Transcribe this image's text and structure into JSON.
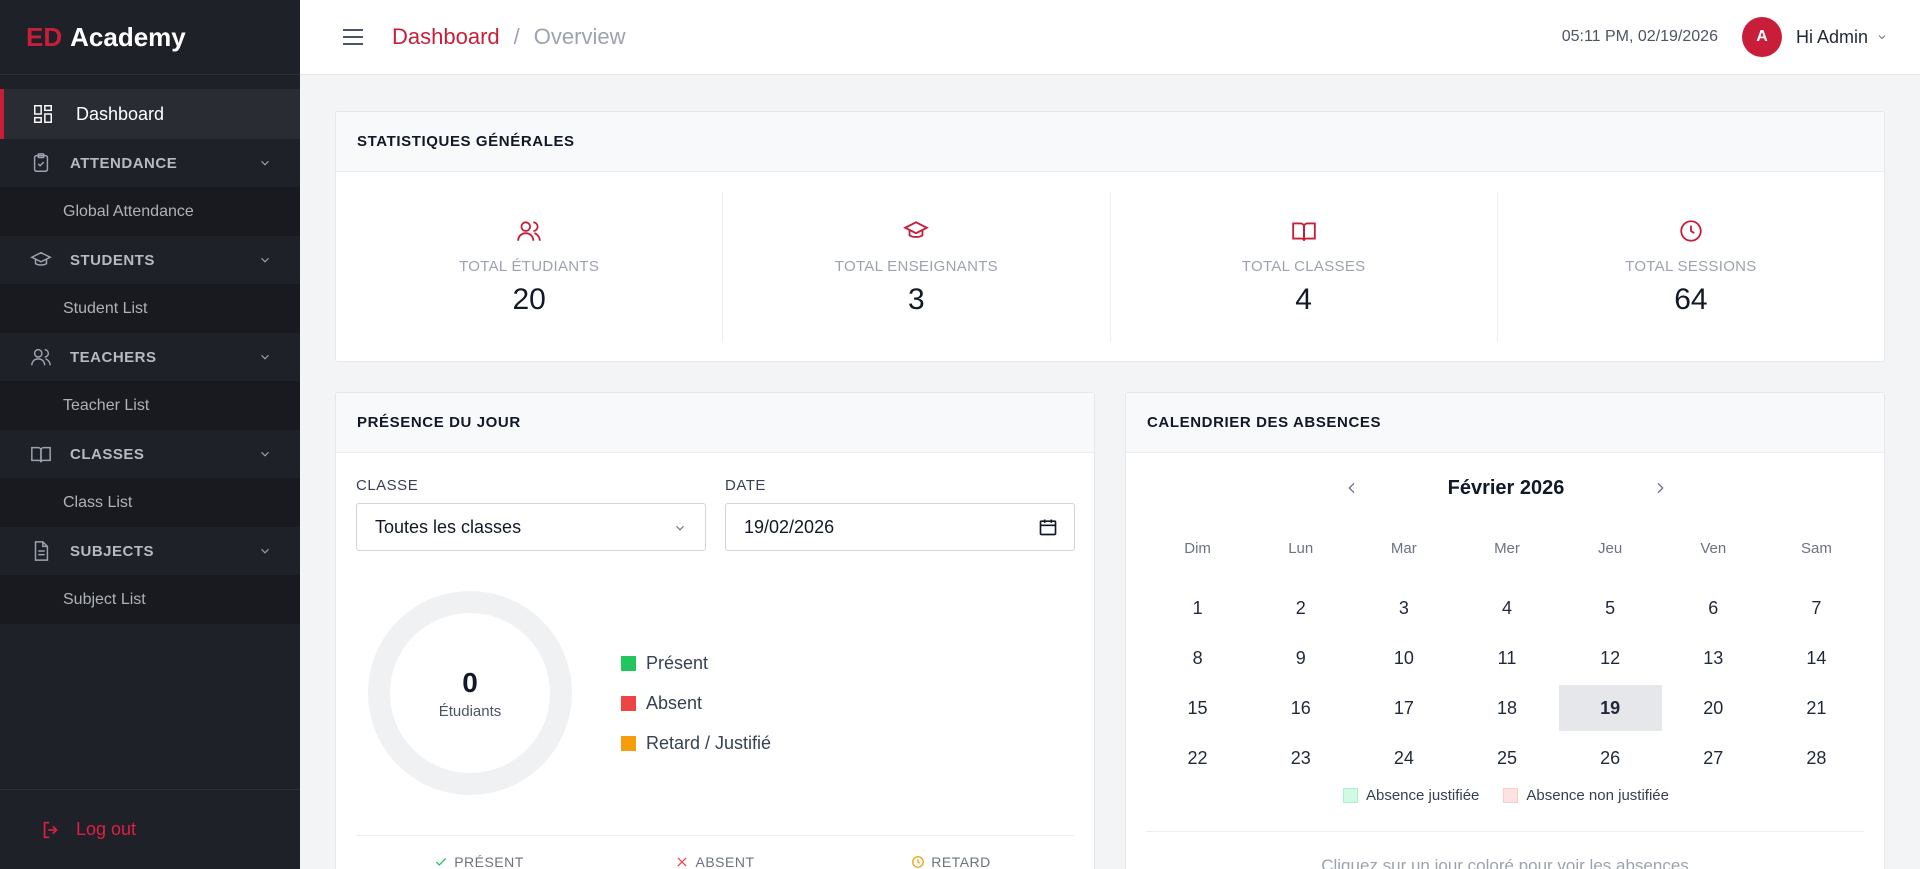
{
  "sidebar": {
    "brand_ed": "ED",
    "brand_name": "Academy",
    "dashboard": "Dashboard",
    "groups": [
      {
        "label": "ATTENDANCE",
        "icon": "clipboard-check-icon",
        "sub": "Global Attendance"
      },
      {
        "label": "STUDENTS",
        "icon": "graduation-cap-icon",
        "sub": "Student List"
      },
      {
        "label": "TEACHERS",
        "icon": "users-icon",
        "sub": "Teacher List"
      },
      {
        "label": "CLASSES",
        "icon": "book-open-icon",
        "sub": "Class List"
      },
      {
        "label": "SUBJECTS",
        "icon": "document-icon",
        "sub": "Subject List"
      }
    ],
    "logout": "Log out"
  },
  "header": {
    "breadcrumb_root": "Dashboard",
    "breadcrumb_sep": "/",
    "breadcrumb_current": "Overview",
    "datetime": "05:11 PM, 02/19/2026",
    "avatar_initial": "A",
    "greeting": "Hi Admin"
  },
  "stats": {
    "title": "STATISTIQUES GÉNÉRALES",
    "items": [
      {
        "label": "TOTAL ÉTUDIANTS",
        "value": "20",
        "icon": "users-icon"
      },
      {
        "label": "TOTAL ENSEIGNANTS",
        "value": "3",
        "icon": "graduation-cap-icon"
      },
      {
        "label": "TOTAL CLASSES",
        "value": "4",
        "icon": "book-open-icon"
      },
      {
        "label": "TOTAL SESSIONS",
        "value": "64",
        "icon": "clock-icon"
      }
    ]
  },
  "presence": {
    "title": "PRÉSENCE DU JOUR",
    "class_label": "CLASSE",
    "class_value": "Toutes les classes",
    "date_label": "DATE",
    "date_value": "19/02/2026",
    "donut_value": "0",
    "donut_label": "Étudiants",
    "legend": [
      {
        "label": "Présent",
        "color": "#22c55e"
      },
      {
        "label": "Absent",
        "color": "#ef4444"
      },
      {
        "label": "Retard / Justifié",
        "color": "#f59e0b"
      }
    ],
    "bottom_tabs": [
      {
        "label": "PRÉSENT",
        "color": "#22c55e"
      },
      {
        "label": "ABSENT",
        "color": "#ef4444"
      },
      {
        "label": "RETARD",
        "color": "#f59e0b"
      }
    ]
  },
  "calendar": {
    "title": "CALENDRIER DES ABSENCES",
    "month": "Février 2026",
    "days_of_week": [
      "Dim",
      "Lun",
      "Mar",
      "Mer",
      "Jeu",
      "Ven",
      "Sam"
    ],
    "weeks": [
      [
        "1",
        "2",
        "3",
        "4",
        "5",
        "6",
        "7"
      ],
      [
        "8",
        "9",
        "10",
        "11",
        "12",
        "13",
        "14"
      ],
      [
        "15",
        "16",
        "17",
        "18",
        "19",
        "20",
        "21"
      ],
      [
        "22",
        "23",
        "24",
        "25",
        "26",
        "27",
        "28"
      ]
    ],
    "today": "19",
    "legend": [
      {
        "label": "Absence justifiée",
        "color": "#d1fae5",
        "border": "#a7f3d0"
      },
      {
        "label": "Absence non justifiée",
        "color": "#fee2e2",
        "border": "#fecaca"
      }
    ],
    "hint": "Cliquez sur un jour coloré pour voir les absences"
  },
  "colors": {
    "accent": "#c81e3a",
    "sidebar_bg": "#1f2128"
  }
}
